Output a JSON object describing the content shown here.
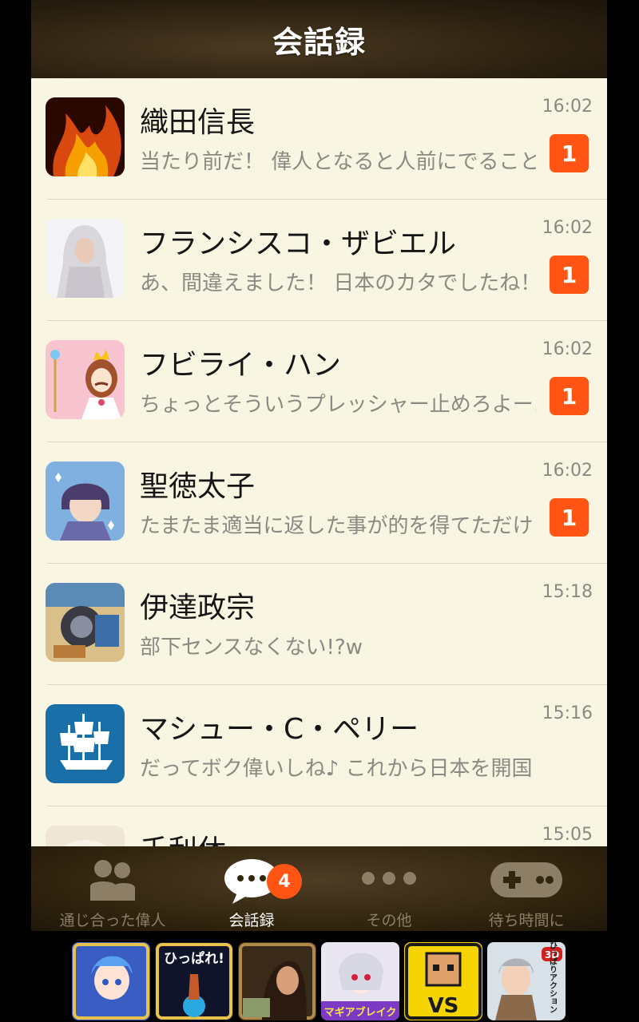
{
  "header": {
    "title": "会話録"
  },
  "conversations": [
    {
      "name": "織田信長",
      "message": "当たり前だ！ 偉人となると人前にでること",
      "time": "16:02",
      "unread": "1",
      "avatar": "fire-avatar"
    },
    {
      "name": "フランシスコ・ザビエル",
      "message": "あ、間違えました！ 日本のカタでしたね！",
      "time": "16:02",
      "unread": "1",
      "avatar": "madonna-avatar"
    },
    {
      "name": "フビライ・ハン",
      "message": "ちょっとそういうプレッシャー止めろよー…",
      "time": "16:02",
      "unread": "1",
      "avatar": "princess-avatar"
    },
    {
      "name": "聖徳太子",
      "message": "たまたま適当に返した事が的を得てただけ",
      "time": "16:02",
      "unread": "1",
      "avatar": "anime-avatar"
    },
    {
      "name": "伊達政宗",
      "message": "部下センスなくない!?w",
      "time": "15:18",
      "unread": "",
      "avatar": "machine-avatar"
    },
    {
      "name": "マシュー・C・ペリー",
      "message": "だってボク偉いしね♪ これから日本を開国",
      "time": "15:16",
      "unread": "",
      "avatar": "ship-avatar"
    },
    {
      "name": "千利休",
      "message": "",
      "time": "15:05",
      "unread": "",
      "avatar": "tea-avatar"
    }
  ],
  "tabs": [
    {
      "label": "通じ合った偉人",
      "icon": "people-icon",
      "active": false
    },
    {
      "label": "会話録",
      "icon": "chat-bubble-icon",
      "active": true,
      "badge": "4"
    },
    {
      "label": "その他",
      "icon": "more-dots-icon",
      "active": false
    },
    {
      "label": "待ち時間に",
      "icon": "gamepad-icon",
      "active": false
    }
  ],
  "ads": {
    "ad2_text": "ひっぱれ!",
    "ad4_text": "マギアブレイク",
    "ad5_text": "VS",
    "ad6_badge": "3D",
    "ad6_text": "ひっぱりアクション"
  },
  "colors": {
    "accent": "#ff5414",
    "list_background": "#f8f6e3",
    "header_brown": "#2f2312"
  }
}
